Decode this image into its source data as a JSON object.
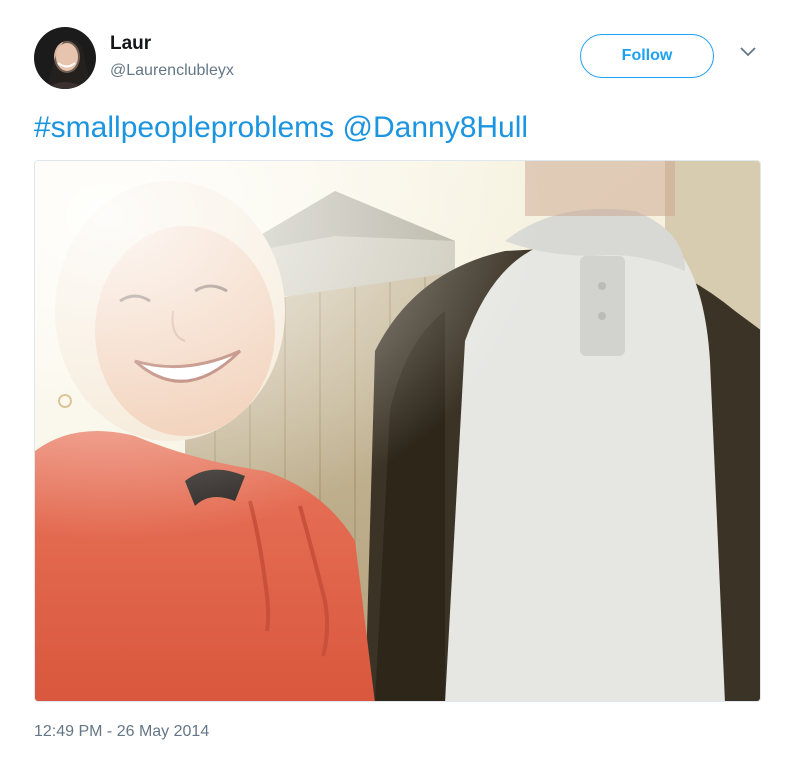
{
  "user": {
    "display_name": "Laur",
    "handle": "@Laurenclubleyx",
    "avatar_icon": "profile-photo"
  },
  "actions": {
    "follow_label": "Follow",
    "menu_icon": "chevron-down-icon"
  },
  "tweet": {
    "hashtag": "#smallpeopleproblems",
    "mention": "@Danny8Hull",
    "media_description_icon": "photo"
  },
  "meta": {
    "timestamp": "12:49 PM - 26 May 2014"
  },
  "colors": {
    "link": "#1b95e0",
    "follow": "#1da1f2",
    "secondary_text": "#657786"
  }
}
